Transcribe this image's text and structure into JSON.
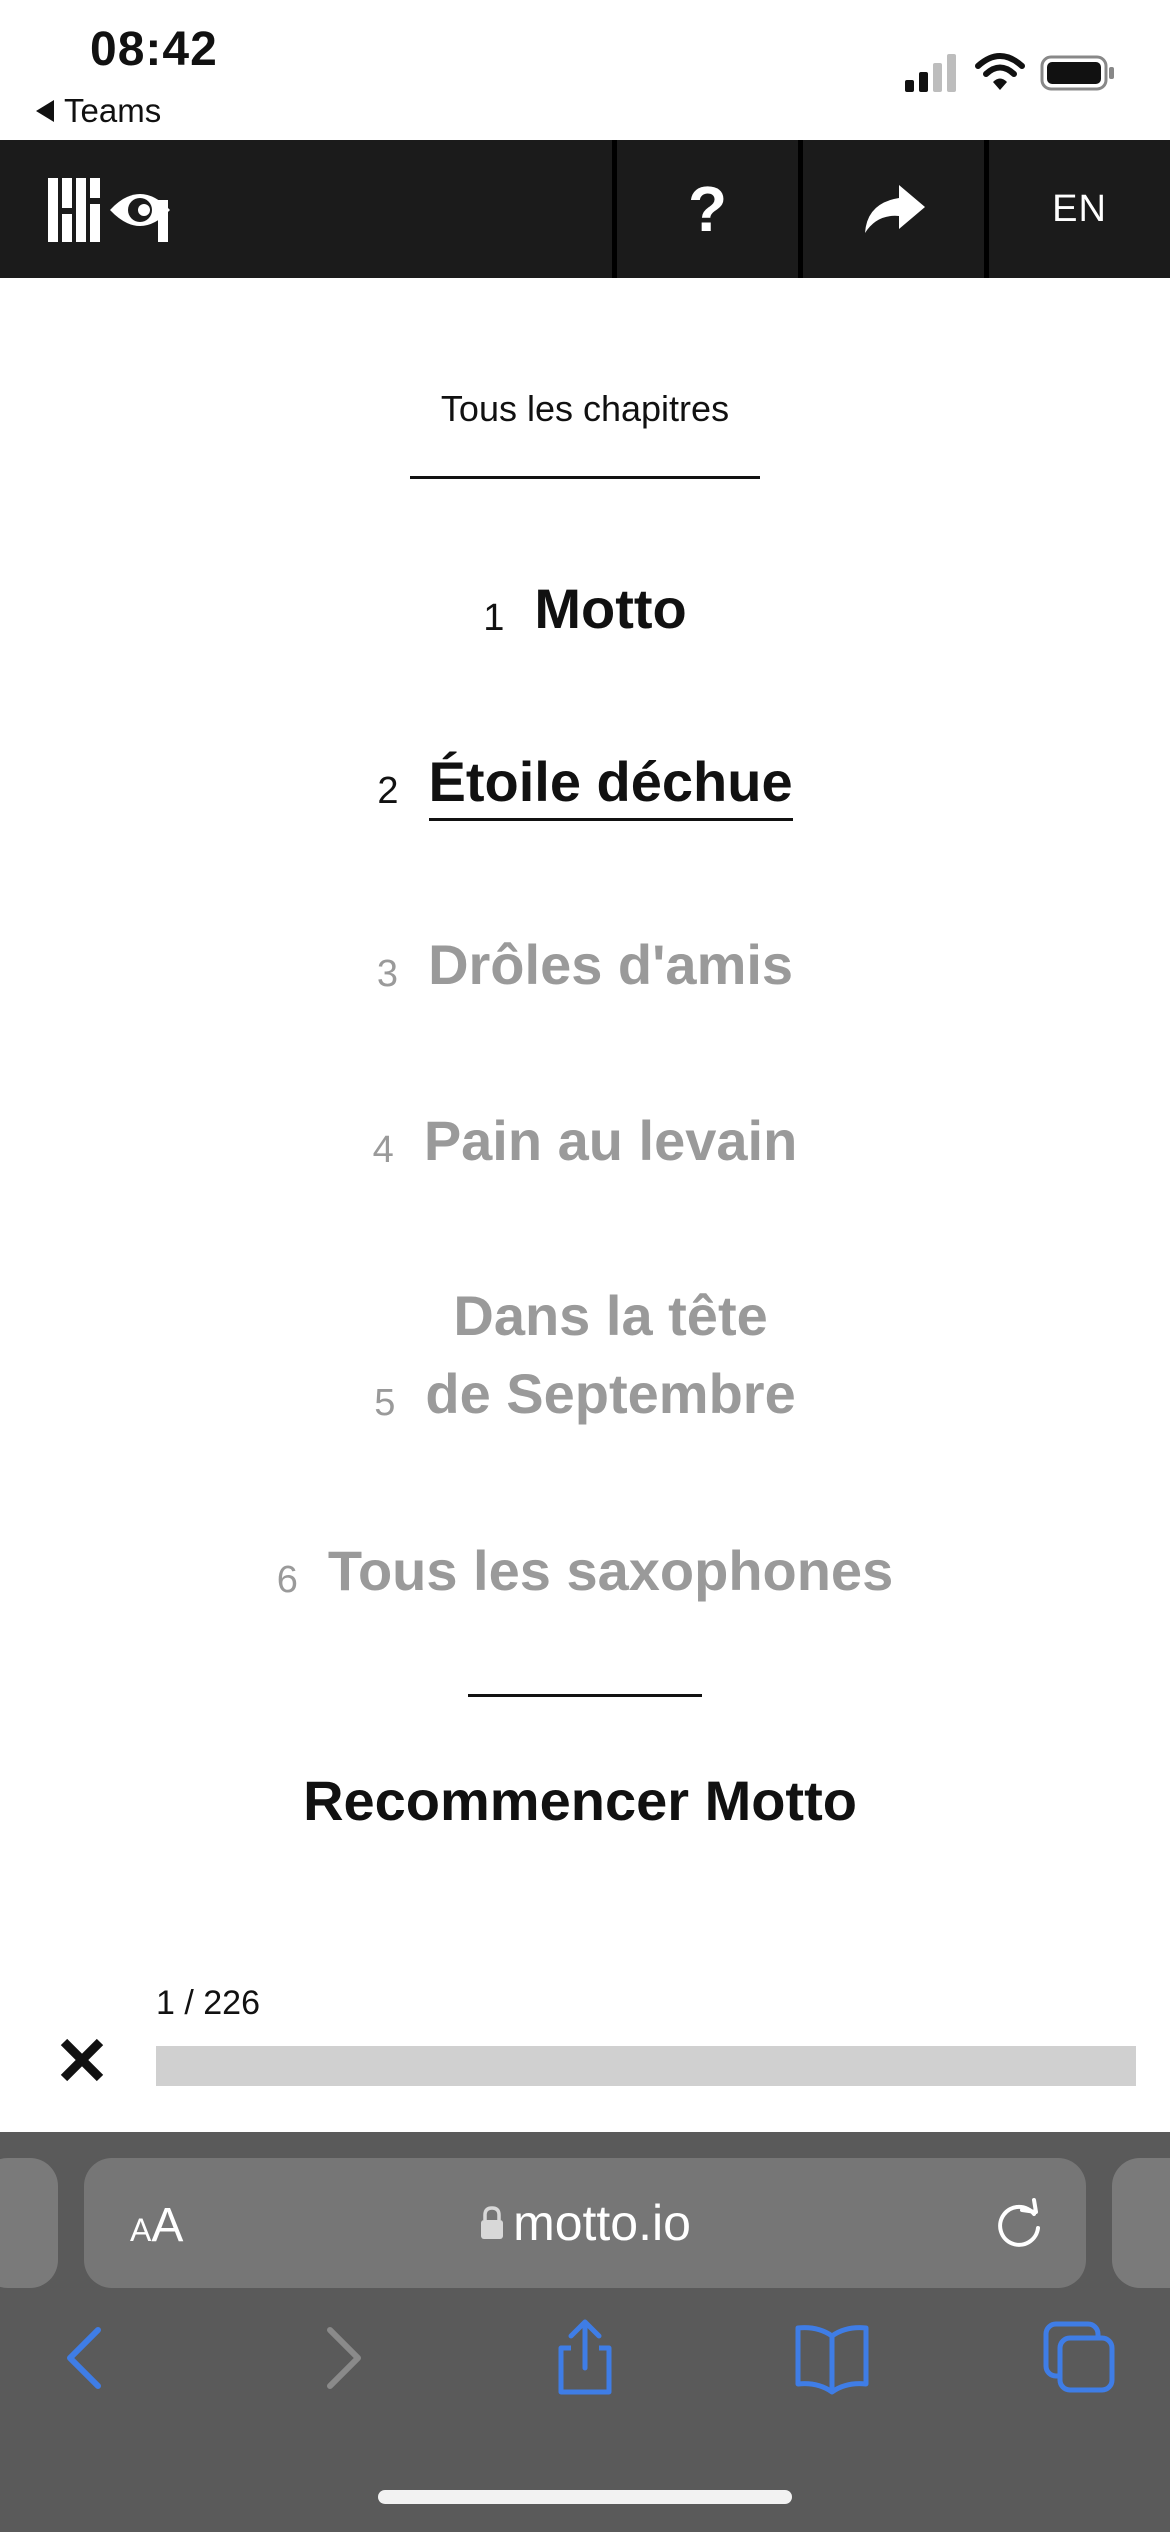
{
  "status_bar": {
    "time": "08:42",
    "back_app": "Teams"
  },
  "nav": {
    "help": "?",
    "language": "EN"
  },
  "chapters": {
    "heading": "Tous les chapitres",
    "items": [
      {
        "number": "1",
        "title": "Motto",
        "state": "visited"
      },
      {
        "number": "2",
        "title": "Étoile déchue",
        "state": "current"
      },
      {
        "number": "3",
        "title": "Drôles d'amis",
        "state": "locked"
      },
      {
        "number": "4",
        "title": "Pain au levain",
        "state": "locked"
      },
      {
        "number": "5",
        "title_line1": "Dans la tête",
        "title_line2": "de Septembre",
        "state": "locked"
      },
      {
        "number": "6",
        "title": "Tous les saxophones",
        "state": "locked"
      }
    ],
    "restart_label": "Recommencer Motto"
  },
  "progress": {
    "label": "1 / 226",
    "current": 1,
    "total": 226
  },
  "browser": {
    "aa_small": "A",
    "aa_large": "A",
    "url": "motto.io"
  },
  "colors": {
    "nav_bg": "#1b1b1b",
    "muted_text": "#9a9a9a",
    "browser_bg": "#5a5a5a",
    "ios_blue": "#3f7de6"
  }
}
